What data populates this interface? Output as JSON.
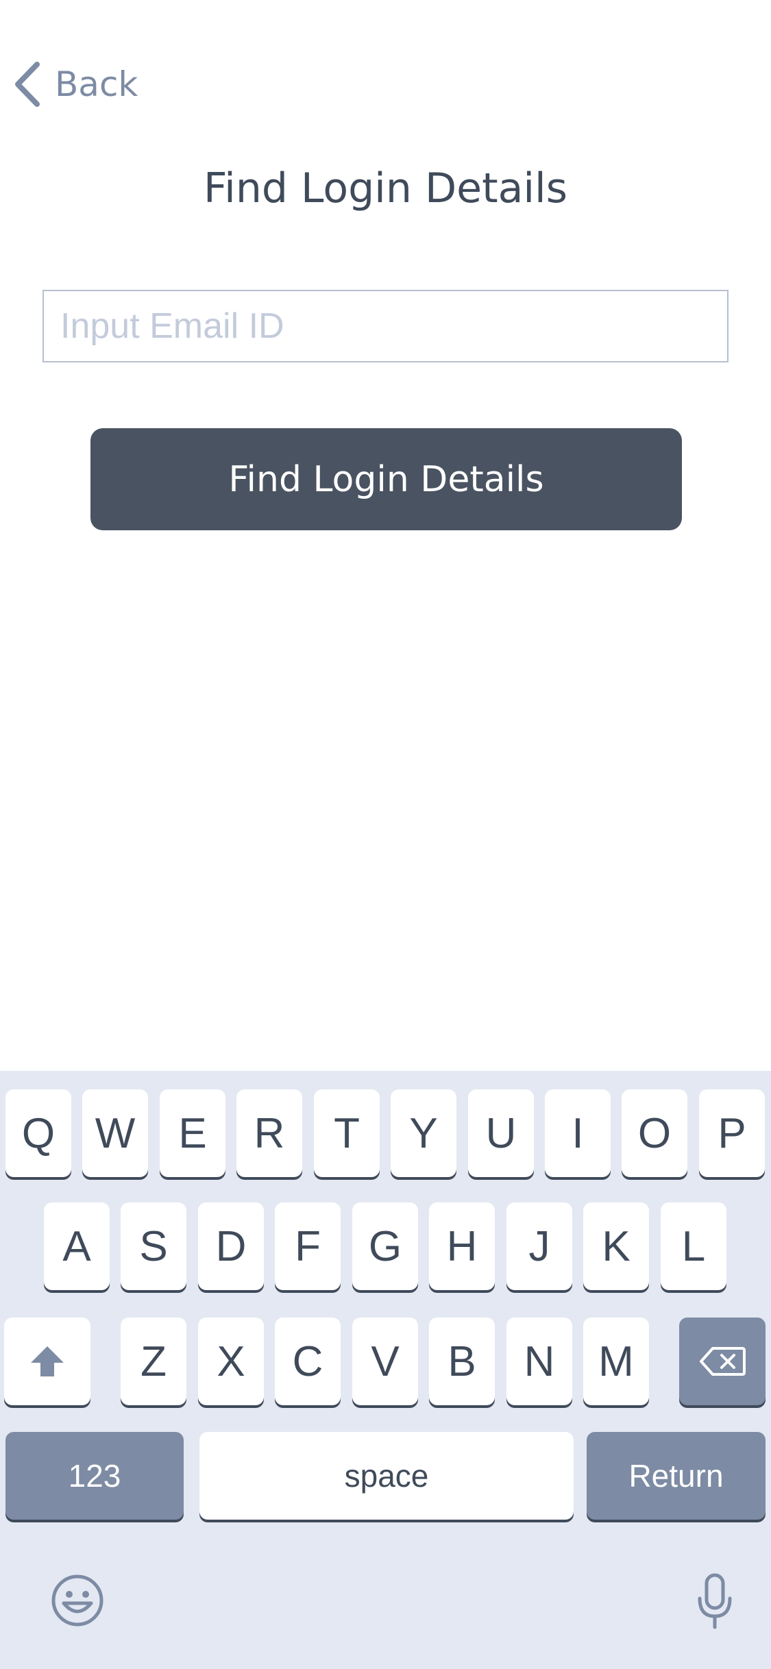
{
  "header": {
    "back_label": "Back"
  },
  "title": "Find Login Details",
  "email": {
    "value": "",
    "placeholder": "Input Email ID"
  },
  "button": {
    "label": "Find Login Details"
  },
  "keyboard": {
    "row1": [
      "Q",
      "W",
      "E",
      "R",
      "T",
      "Y",
      "U",
      "I",
      "O",
      "P"
    ],
    "row2": [
      "A",
      "S",
      "D",
      "F",
      "G",
      "H",
      "J",
      "K",
      "L"
    ],
    "row3": [
      "Z",
      "X",
      "C",
      "V",
      "B",
      "N",
      "M"
    ],
    "numbers_label": "123",
    "space_label": "space",
    "return_label": "Return",
    "icons": [
      "shift-icon",
      "backspace-icon",
      "emoji-icon",
      "microphone-icon"
    ]
  },
  "colors": {
    "text_dark": "#3f4a5a",
    "muted": "#7d8ba4",
    "placeholder": "#c3cbdb",
    "button_bg": "#4a5361",
    "keyboard_bg": "#e3e8f2"
  }
}
